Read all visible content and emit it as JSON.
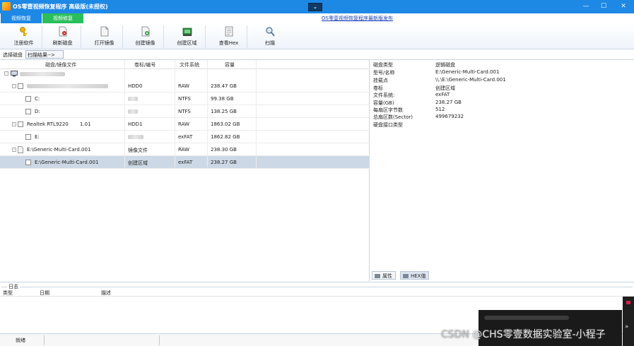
{
  "window": {
    "title": "OS零壹视频恢复程序 高级版(未授权)",
    "dropdown_glyph": "⌄",
    "minimize": "—",
    "maximize": "☐",
    "close": "✕"
  },
  "tabs": {
    "tab1": "视频恢复",
    "tab2": "视频修复",
    "update_link": "OS零壹视频恢复程序最新版发布"
  },
  "toolbar": {
    "register": "注册软件",
    "refresh": "刷新磁盘",
    "open_image": "打开镜像",
    "create_image": "创建镜像",
    "create_region": "创建区域",
    "view_hex": "查看Hex",
    "scan": "扫描"
  },
  "crumbs": {
    "select_disk": "选择磁盘",
    "scan_result": "扫描结果-->"
  },
  "disk_table": {
    "headers": [
      "磁盘/镜像文件",
      "卷标/编号",
      "文件系统",
      "容量"
    ],
    "rows": [
      {
        "name": "",
        "id": "HDD0",
        "fs": "RAW",
        "size": "238.47 GB"
      },
      {
        "name": "C:",
        "id": "",
        "fs": "NTFS",
        "size": "99.38 GB"
      },
      {
        "name": "D:",
        "id": "",
        "fs": "NTFS",
        "size": "138.25 GB"
      },
      {
        "name": "Realtek RTL9220",
        "ver": "1.01",
        "id": "HDD1",
        "fs": "RAW",
        "size": "1863.02 GB"
      },
      {
        "name": "E:",
        "id": "",
        "fs": "exFAT",
        "size": "1862.82 GB"
      },
      {
        "name": "E:\\Generic-Multi-Card.001",
        "id": "镜像文件",
        "fs": "RAW",
        "size": "238.30 GB"
      },
      {
        "name": "E:\\Generic-Multi-Card.001",
        "id": "创建区域",
        "fs": "exFAT",
        "size": "238.27 GB"
      }
    ]
  },
  "properties": {
    "rows": [
      {
        "k": "磁盘类型",
        "v": "逻辑磁盘"
      },
      {
        "k": "型号/名称",
        "v": "E:\\Generic-Multi-Card.001"
      },
      {
        "k": "挂载点",
        "v": "\\\\.\\E:\\Generic-Multi-Card.001"
      },
      {
        "k": "卷标",
        "v": "创建区域"
      },
      {
        "k": "文件系统:",
        "v": "exFAT"
      },
      {
        "k": "容量(GB)",
        "v": "238.27 GB"
      },
      {
        "k": "每扇区字节数",
        "v": "512"
      },
      {
        "k": "总扇区数(Sector)",
        "v": "499679232"
      },
      {
        "k": "硬盘接口类型",
        "v": ""
      }
    ],
    "tab_props": "属性",
    "tab_hex": "HEX值"
  },
  "log": {
    "title": "日志",
    "col_type": "类型",
    "col_date": "日期",
    "col_desc": "描述"
  },
  "status": {
    "text": "就绪"
  },
  "watermark": {
    "csdn": "CSDN",
    "text": "@CHS零壹数据实验室-小程子"
  },
  "colors": {
    "titlebar": "#1e88e5",
    "tab_active": "#1e88e5",
    "tab_second": "#2bbf5c",
    "selected_row": "#cdd8e6"
  }
}
